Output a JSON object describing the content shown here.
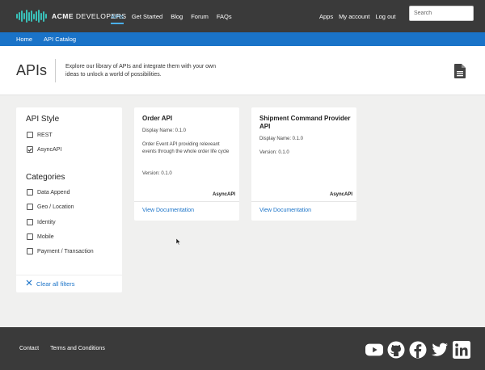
{
  "brand": {
    "name_bold": "ACME",
    "name_rest": " DEVELOPERS"
  },
  "nav": {
    "items": [
      {
        "label": "APIs",
        "active": true
      },
      {
        "label": "Get Started"
      },
      {
        "label": "Blog"
      },
      {
        "label": "Forum"
      },
      {
        "label": "FAQs"
      }
    ],
    "right_items": [
      {
        "label": "Apps"
      },
      {
        "label": "My account"
      },
      {
        "label": "Log out"
      }
    ],
    "search_placeholder": "Search"
  },
  "breadcrumb": [
    {
      "label": "Home"
    },
    {
      "label": "API Catalog"
    }
  ],
  "header": {
    "title": "APIs",
    "description": "Explore our library of APIs and integrate them with your own ideas to unlock a world of possibilities."
  },
  "filters": {
    "style_heading": "API Style",
    "styles": [
      {
        "label": "REST",
        "checked": false
      },
      {
        "label": "AsyncAPI",
        "checked": true
      }
    ],
    "categories_heading": "Categories",
    "categories": [
      {
        "label": "Data Append",
        "checked": false
      },
      {
        "label": "Geo / Location",
        "checked": false
      },
      {
        "label": "Identity",
        "checked": false
      },
      {
        "label": "Mobile",
        "checked": false
      },
      {
        "label": "Payment / Transaction",
        "checked": false
      }
    ],
    "clear_label": "Clear all filters"
  },
  "cards": [
    {
      "title": "Order API",
      "display_name": "Display Name: 0.1.0",
      "description": "Order Event API providing releveant events through the whole order life cycle",
      "version": "Version: 0.1.0",
      "type": "AsyncAPI",
      "link": "View Documentation"
    },
    {
      "title": "Shipment Command Provider API",
      "display_name": "Display Name: 0.1.0",
      "version": "Version: 0.1.0",
      "type": "AsyncAPI",
      "link": "View Documentation"
    }
  ],
  "footer": {
    "links": [
      {
        "label": "Contact"
      },
      {
        "label": "Terms and Conditions"
      }
    ],
    "social": [
      "youtube-icon",
      "github-icon",
      "facebook-icon",
      "twitter-icon",
      "linkedin-icon"
    ]
  },
  "colors": {
    "accent": "#1a73c8",
    "topbar": "#3a3a3a",
    "brand": "#39c0b8"
  }
}
